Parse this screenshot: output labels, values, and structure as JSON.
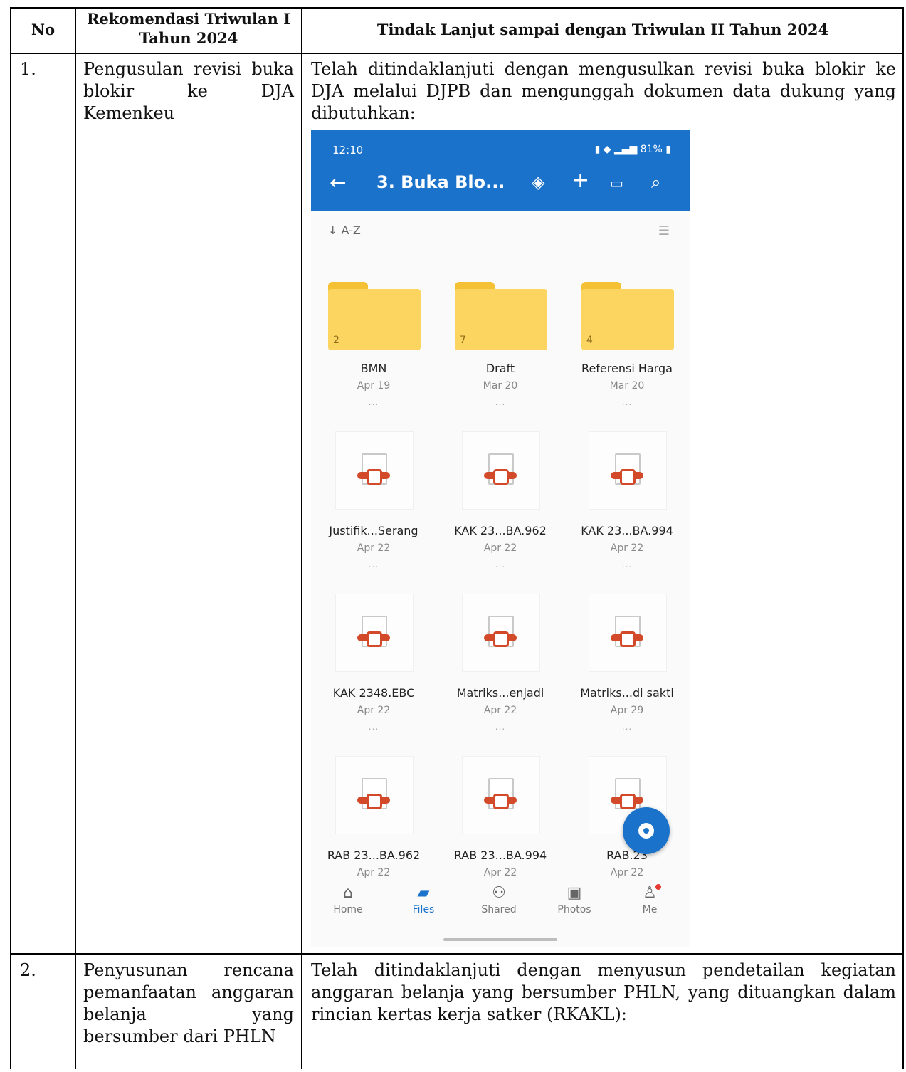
{
  "table": {
    "headers": {
      "no": "No",
      "rekomendasi": "Rekomendasi Triwulan I Tahun 2024",
      "tindak_lanjut": "Tindak Lanjut sampai dengan Triwulan II Tahun 2024"
    },
    "rows": [
      {
        "no": "1.",
        "rekomendasi_lines": [
          "Pengusulan revisi buka",
          "blokir ke DJA",
          "Kemenkeu"
        ],
        "tindak_lanjut_lines": [
          "Telah ditindaklanjuti dengan mengusulkan revisi buka blokir ke",
          "DJA melalui DJPB dan mengunggah dokumen data dukung yang",
          "dibutuhkan:"
        ]
      },
      {
        "no": "2.",
        "rekomendasi_lines": [
          "Penyusunan rencana",
          "pemanfaatan anggaran",
          "belanja yang",
          "bersumber dari PHLN"
        ],
        "tindak_lanjut_lines": [
          "Telah ditindaklanjuti dengan menyusun pendetailan kegiatan",
          "anggaran belanja yang bersumber PHLN, yang dituangkan dalam",
          "rincian kertas kerja satker (RKAKL):"
        ]
      }
    ]
  },
  "phone": {
    "status_time": "12:10",
    "status_battery": "81%",
    "title": "3. Buka Blo...",
    "sort_label": "A-Z",
    "icons": [
      "back-arrow-icon",
      "premium-diamond-icon",
      "add-icon",
      "cast-icon",
      "search-icon",
      "list-view-icon",
      "camera-icon"
    ],
    "folders": [
      {
        "name": "BMN",
        "date": "Apr 19",
        "count": "2"
      },
      {
        "name": "Draft",
        "date": "Mar 20",
        "count": "7"
      },
      {
        "name": "Referensi Harga",
        "date": "Mar 20",
        "count": "4"
      }
    ],
    "files": [
      {
        "name": "Justifik...Serang",
        "date": "Apr 22"
      },
      {
        "name": "KAK 23...BA.962",
        "date": "Apr 22"
      },
      {
        "name": "KAK 23...BA.994",
        "date": "Apr 22"
      },
      {
        "name": "KAK 2348.EBC",
        "date": "Apr 22"
      },
      {
        "name": "Matriks...enjadi",
        "date": "Apr 22"
      },
      {
        "name": "Matriks...di sakti",
        "date": "Apr 29"
      },
      {
        "name": "RAB 23...BA.962",
        "date": "Apr 22"
      },
      {
        "name": "RAB 23...BA.994",
        "date": "Apr 22"
      },
      {
        "name": "RAB.23",
        "date": "Apr 22"
      }
    ],
    "more": "...",
    "nav": [
      {
        "label": "Home",
        "icon": "home-icon"
      },
      {
        "label": "Files",
        "icon": "folder-icon"
      },
      {
        "label": "Shared",
        "icon": "people-icon"
      },
      {
        "label": "Photos",
        "icon": "photo-icon"
      },
      {
        "label": "Me",
        "icon": "person-icon"
      }
    ]
  }
}
